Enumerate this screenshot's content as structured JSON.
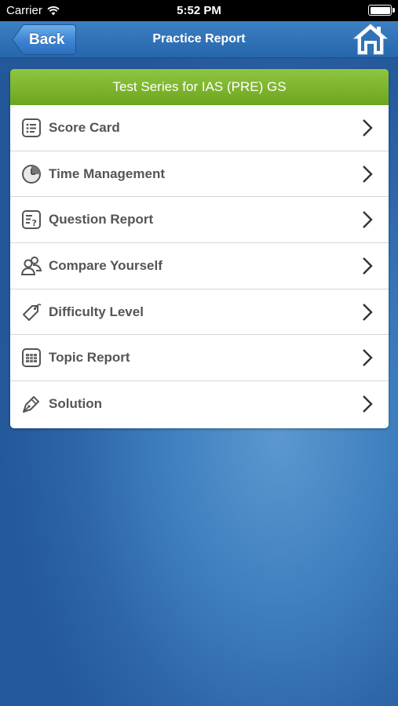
{
  "status_bar": {
    "carrier": "Carrier",
    "time": "5:52 PM"
  },
  "nav": {
    "back_label": "Back",
    "title": "Practice Report"
  },
  "card": {
    "header": "Test Series for IAS (PRE) GS",
    "items": [
      {
        "label": "Score Card",
        "icon": "score-card-icon"
      },
      {
        "label": "Time Management",
        "icon": "clock-icon"
      },
      {
        "label": "Question Report",
        "icon": "question-report-icon"
      },
      {
        "label": "Compare Yourself",
        "icon": "compare-people-icon"
      },
      {
        "label": "Difficulty Level",
        "icon": "tag-icon"
      },
      {
        "label": "Topic Report",
        "icon": "topic-table-icon"
      },
      {
        "label": "Solution",
        "icon": "pen-icon"
      }
    ]
  },
  "colors": {
    "nav": "#2f72b6",
    "header_green": "#7db72f",
    "text": "#555555"
  }
}
